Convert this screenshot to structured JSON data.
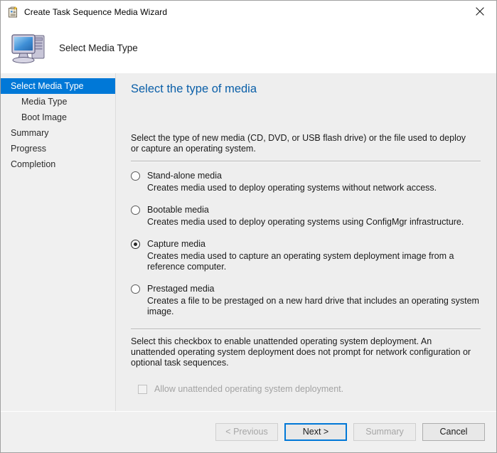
{
  "window": {
    "title": "Create Task Sequence Media Wizard",
    "titlebar_icon": "task-sequence-clipboard-icon",
    "close_label": "Close",
    "header_title": "Select Media Type",
    "header_icon": "computer-monitor-icon"
  },
  "sidebar": {
    "items": [
      {
        "label": "Select Media Type",
        "level": 0,
        "active": true
      },
      {
        "label": "Media Type",
        "level": 1,
        "active": false
      },
      {
        "label": "Boot Image",
        "level": 1,
        "active": false
      },
      {
        "label": "Summary",
        "level": 0,
        "active": false
      },
      {
        "label": "Progress",
        "level": 0,
        "active": false
      },
      {
        "label": "Completion",
        "level": 0,
        "active": false
      }
    ]
  },
  "content": {
    "heading": "Select the type of media",
    "intro": "Select the type of new media (CD, DVD, or USB flash drive) or the file used to deploy or capture an operating system.",
    "options": [
      {
        "label": "Stand-alone media",
        "description": "Creates media used to deploy operating systems without network access.",
        "selected": false
      },
      {
        "label": "Bootable media",
        "description": "Creates media used to deploy operating systems using ConfigMgr infrastructure.",
        "selected": false
      },
      {
        "label": "Capture media",
        "description": "Creates media used to capture an operating system deployment image from a reference computer.",
        "selected": true
      },
      {
        "label": "Prestaged media",
        "description": "Creates a file to be prestaged on a new hard drive that includes an operating system image.",
        "selected": false
      }
    ],
    "checkbox_help": "Select this checkbox to enable unattended operating system deployment. An unattended operating system deployment does not prompt for network configuration or optional task sequences.",
    "checkbox": {
      "label": "Allow unattended operating system deployment.",
      "checked": false,
      "disabled": true
    }
  },
  "footer": {
    "buttons": [
      {
        "label": "< Previous",
        "state": "disabled"
      },
      {
        "label": "Next >",
        "state": "default"
      },
      {
        "label": "Summary",
        "state": "disabled"
      },
      {
        "label": "Cancel",
        "state": "normal"
      }
    ]
  },
  "colors": {
    "accent": "#0078d7",
    "heading": "#0a5fa8",
    "window_bg": "#f0f0f0",
    "content_bg": "#eeeeee",
    "disabled_text": "#a3a3a3"
  }
}
